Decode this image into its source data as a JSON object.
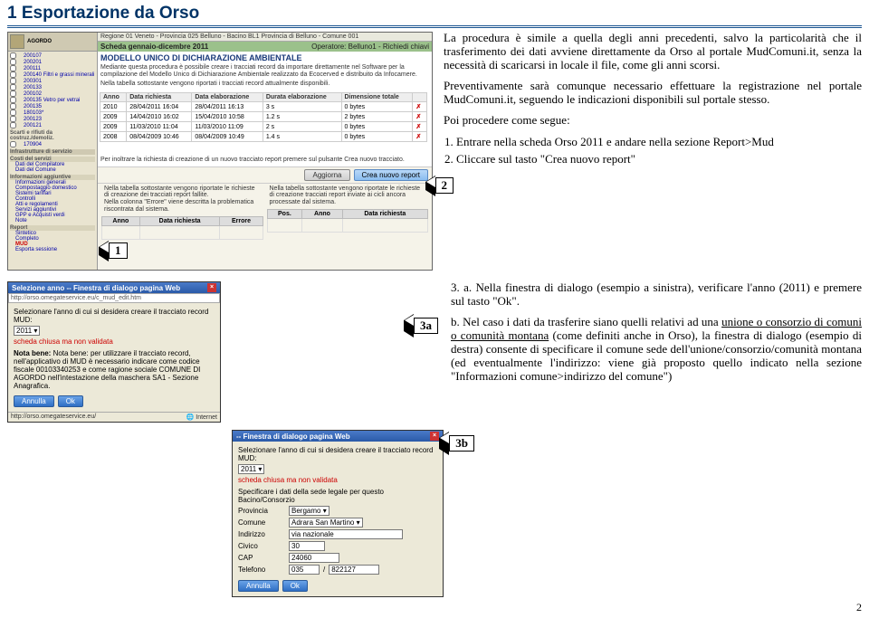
{
  "header": {
    "title": "1  Esportazione da Orso"
  },
  "intro": {
    "p1": "La procedura è simile a quella degli anni precedenti, salvo la particolarità che il trasferimento dei dati avviene direttamente da Orso al portale MudComuni.it, senza la necessità di scaricarsi in locale il file, come gli anni scorsi.",
    "p2": "Preventivamente sarà comunque necessario effettuare la registrazione nel portale MudComuni.it, seguendo le indicazioni disponibili sul portale stesso.",
    "procHead": "Poi procedere come segue:",
    "step1": "Entrare nella scheda Orso 2011 e andare nella sezione Report>Mud",
    "step2": "Cliccare sul tasto \"Crea nuovo report\""
  },
  "ss1": {
    "topbar": "Regione 01 Veneto - Provincia 025 Belluno - Bacino BL1 Provincia di Belluno - Comune 001",
    "brand": "AGORDO",
    "period": "Scheda gennaio-dicembre 2011",
    "operator": "Operatore: Belluno1 - Richiedi chiavi",
    "formTitle": "Modello Unico di Dichiarazione Ambientale",
    "formDesc": "Mediante questa procedura è possibile creare i tracciati record da importare direttamente nel Software per la compilazione del Modello Unico di Dichiarazione Ambientale realizzato da Ecocerved e distribuito da Infocamere.",
    "formDesc2": "Nella tabella sottostante vengono riportati i tracciati record attualmente disponibili.",
    "th": {
      "anno": "Anno",
      "drich": "Data richiesta",
      "delab": "Data elaborazione",
      "durata": "Durata elaborazione",
      "dim": "Dimensione totale",
      "x": ""
    },
    "rows": [
      {
        "anno": "2010",
        "drich": "28/04/2011 16:04",
        "delab": "28/04/2011 16:13",
        "durata": "3 s",
        "dim": "0 bytes"
      },
      {
        "anno": "2009",
        "drich": "14/04/2010 16:02",
        "delab": "15/04/2010 10:58",
        "durata": "1.2 s",
        "dim": "2 bytes"
      },
      {
        "anno": "2009",
        "drich": "11/03/2010 11:04",
        "delab": "11/03/2010 11:09",
        "durata": "2 s",
        "dim": "0 bytes"
      },
      {
        "anno": "2008",
        "drich": "08/04/2009 10:46",
        "delab": "08/04/2009 10:49",
        "durata": "1.4 s",
        "dim": "0 bytes"
      }
    ],
    "midText": "Per inoltrare la richiesta di creazione di un nuovo tracciato report premere sul pulsante Crea nuovo tracciato.",
    "btnAggiorna": "Aggiorna",
    "btnCrea": "Crea nuovo report",
    "lowLeft": "Nella tabella sottostante vengono riportate le richieste di creazione dei tracciati report fallite.\nNella colonna \"Errore\" viene descritta la problematica riscontrata dal sistema.",
    "lowRight": "Nella tabella sottostante vengono riportate le richieste di creazione tracciati report inviate ai cicli ancora processate dal sistema.",
    "thL": {
      "a": "Anno",
      "b": "Data richiesta",
      "c": "Errore"
    },
    "thR": {
      "a": "Pos.",
      "b": "Anno",
      "c": "Data richiesta"
    },
    "sidebar": {
      "compilatore": "Dati del Compilatore",
      "comune": "Dati del Comune",
      "infoA": "Informazioni aggiuntive",
      "costi": "Costi del servizi",
      "report": "Report",
      "mud": "MUD",
      "items": [
        "200107",
        "200201",
        "200111",
        "200140 Filtri e grassi minerali",
        "200301",
        "200133",
        "200102",
        "200135 Vetro per vetrai",
        "200135",
        "180103*",
        "200123",
        "200121"
      ],
      "sezA": "Scarti e rifiuti da costruz./demoliz.",
      "sezA1": "170904",
      "sezAhdr": "Infrastrutture di servizio",
      "sezB": "Informazioni generali",
      "sezB1": "Compostaggio domestico",
      "sezB2": "Sistemi tariffari",
      "sezB3": "Controlli",
      "sezB4": "Atti e regolamenti",
      "sezB5": "Servizi aggiuntivi",
      "sezB6": "GPP e Acquisti verdi",
      "sezB7": "Note",
      "sezR1": "Sintetico",
      "sezR2": "Completo",
      "sezR3": "MUD",
      "sezR4": "Esporta sessione"
    }
  },
  "arrows": {
    "one": "1",
    "two": "2",
    "threeA": "3a",
    "threeB": "3b"
  },
  "para3": {
    "a1": "3. a.  Nella finestra di dialogo (esempio a sinistra), verificare l'anno (2011) e premere sul tasto \"Ok\".",
    "b1": "b. Nel caso i dati da trasferire siano quelli relativi ad una ",
    "b_u1": "unione o consorzio di comuni o comunità montana",
    "b2": " (come definiti anche in Orso), la finestra di dialogo (esempio di destra) consente di specificare il comune sede dell'unione/consorzio/comunità montana (ed eventualmente l'indirizzo: viene già proposto quello indicato nella sezione \"Informazioni comune>indirizzo del comune\")"
  },
  "dlg3a": {
    "title": "Selezione anno -- Finestra di dialogo pagina Web",
    "url": "http://orso.omegateservice.eu/c_mud_edit.htm",
    "line1": "Selezionare l'anno di cui si desidera creare il tracciato record MUD:",
    "note": "scheda chiusa ma non validata",
    "notaBene": "Nota bene: per utilizzare il tracciato record, nell'applicativo di MUD è necessario indicare come codice fiscale 00103340253 e come ragione sociale COMUNE DI AGORDO nell'intestazione della maschera SA1 - Sezione Anagrafica.",
    "btnAnnulla": "Annulla",
    "btnOk": "Ok",
    "statusL": "http://orso.omegateservice.eu/",
    "statusR": "Internet",
    "year": "2011"
  },
  "dlg3b": {
    "title": " -- Finestra di dialogo pagina Web",
    "line1": "Selezionare l'anno di cui si desidera creare il tracciato record MUD:",
    "note": "scheda chiusa ma non validata",
    "line2": "Specificare i dati della sede legale per questo Bacino/Consorzio",
    "provL": "Provincia",
    "prov": "Bergamo",
    "comL": "Comune",
    "com": "Adrara San Martino",
    "indL": "Indirizzo",
    "ind": "via nazionale",
    "civL": "Civico",
    "civ": "30",
    "capL": "CAP",
    "cap": "24060",
    "telL": "Telefono",
    "tel1": "035",
    "tel2": "822127",
    "btnAnnulla": "Annulla",
    "btnOk": "Ok",
    "year": "2011"
  },
  "pagenum": "2"
}
